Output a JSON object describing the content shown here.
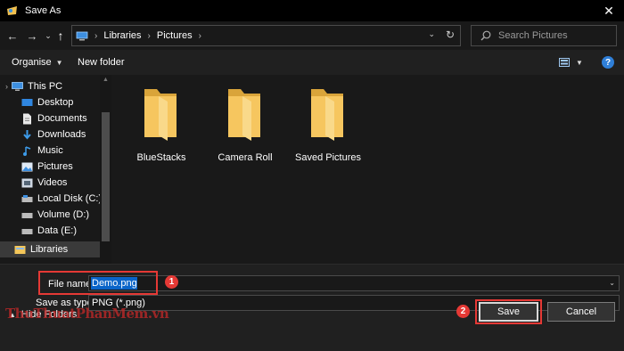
{
  "window": {
    "title": "Save As",
    "close_glyph": "✕"
  },
  "nav": {
    "back": "←",
    "forward": "→",
    "dropdown": "⌄",
    "up": "↑"
  },
  "breadcrumb": [
    "Libraries",
    "Pictures"
  ],
  "breadcrumb_sep": "›",
  "address_controls": {
    "dropdown": "⌄",
    "refresh": "↻"
  },
  "search": {
    "placeholder": "Search Pictures",
    "value": ""
  },
  "toolbar": {
    "organise": "Organise",
    "organise_caret": "▼",
    "new_folder": "New folder",
    "view_caret": "▼",
    "help": "?"
  },
  "sidebar": {
    "items": [
      {
        "label": "This PC",
        "icon": "computer-icon"
      },
      {
        "label": "Desktop",
        "icon": "desktop-icon"
      },
      {
        "label": "Documents",
        "icon": "documents-icon"
      },
      {
        "label": "Downloads",
        "icon": "downloads-icon"
      },
      {
        "label": "Music",
        "icon": "music-icon"
      },
      {
        "label": "Pictures",
        "icon": "pictures-icon"
      },
      {
        "label": "Videos",
        "icon": "videos-icon"
      },
      {
        "label": "Local Disk (C:)",
        "icon": "drive-icon"
      },
      {
        "label": "Volume (D:)",
        "icon": "drive-icon"
      },
      {
        "label": "Data (E:)",
        "icon": "drive-icon"
      },
      {
        "label": "Libraries",
        "icon": "libraries-icon",
        "selected": true
      }
    ],
    "expand_glyph": "›",
    "scroll_up": "▲"
  },
  "folders": [
    {
      "name": "BlueStacks"
    },
    {
      "name": "Camera Roll"
    },
    {
      "name": "Saved Pictures"
    }
  ],
  "save_form": {
    "file_name_label": "File name:",
    "file_name_value": "Demo.png",
    "save_type_label": "Save as type:",
    "save_type_value": "PNG (*.png)",
    "dropdown_glyph": "⌄"
  },
  "annotations": {
    "badge1": "1",
    "badge2": "2",
    "highlight_color": "#e53935"
  },
  "footer": {
    "hide_folders": "Hide Folders",
    "hide_folders_caret": "▲",
    "watermark": "ThuThuatPhanMem.vn"
  },
  "buttons": {
    "save": "Save",
    "cancel": "Cancel"
  },
  "colors": {
    "selection": "#0a64c8",
    "folder": "#f5c45e",
    "help": "#2f7fd8"
  }
}
